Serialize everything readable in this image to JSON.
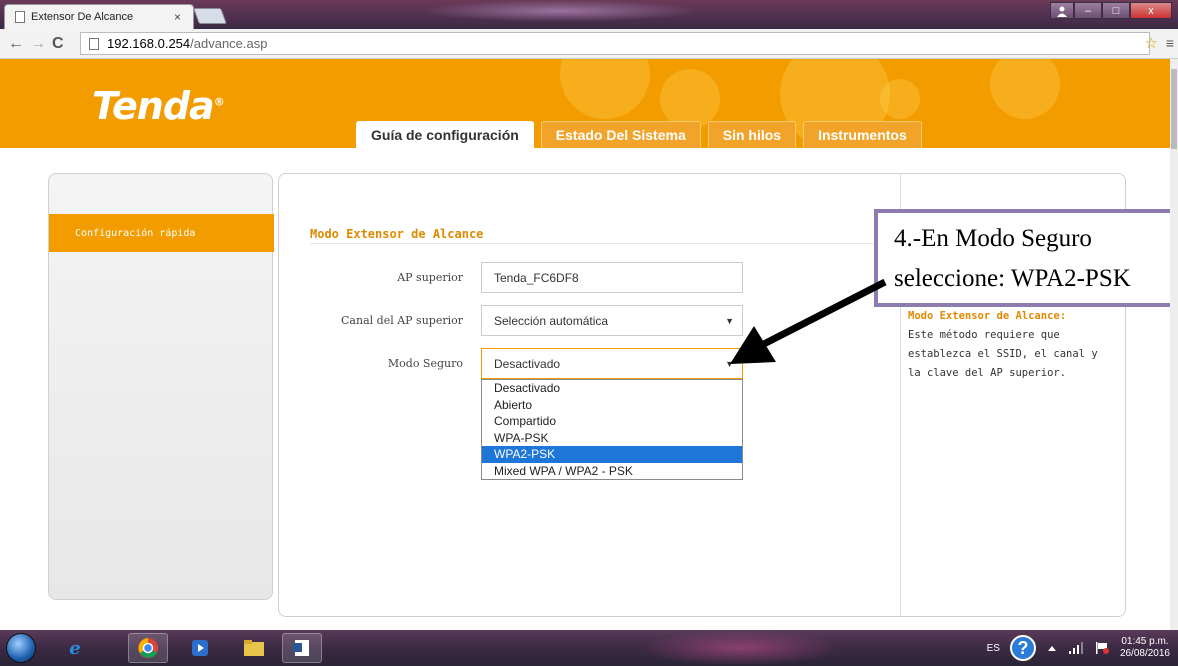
{
  "browser": {
    "tab_title": "Extensor De Alcance",
    "tab_close": "×",
    "url_host": "192.168.0.254",
    "url_path": "/advance.asp",
    "nav_back": "←",
    "nav_forward": "→",
    "nav_reload": "C",
    "star": "☆",
    "menu": "≡",
    "window_minimize": "–",
    "window_maximize": "□",
    "window_close": "x"
  },
  "header": {
    "logo": "Tenda",
    "logo_reg": "®",
    "tabs": [
      {
        "label": "Guía de configuración",
        "active": true
      },
      {
        "label": "Estado Del Sistema",
        "active": false
      },
      {
        "label": "Sin hilos",
        "active": false
      },
      {
        "label": "Instrumentos",
        "active": false
      }
    ]
  },
  "sidebar": {
    "items": [
      {
        "label": "Configuración rápida",
        "active": true
      }
    ]
  },
  "form": {
    "section_title": "Modo Extensor de Alcance",
    "ap_label": "AP superior",
    "ap_value": "Tenda_FC6DF8",
    "channel_label": "Canal del AP superior",
    "channel_value": "Selección automática",
    "security_label": "Modo Seguro",
    "security_value": "Desactivado",
    "dropdown_arrow": "▼",
    "security_options": [
      {
        "label": "Desactivado",
        "selected": false
      },
      {
        "label": "Abierto",
        "selected": false
      },
      {
        "label": "Compartido",
        "selected": false
      },
      {
        "label": "WPA-PSK",
        "selected": false
      },
      {
        "label": "WPA2-PSK",
        "selected": true
      },
      {
        "label": "Mixed WPA / WPA2 - PSK",
        "selected": false
      }
    ]
  },
  "help": {
    "title": "Modo Extensor de Alcance:",
    "body": "Este método requiere que establezca el SSID, el canal y la clave del AP superior."
  },
  "annotation": {
    "line1": "4.-En Modo Seguro",
    "line2": "seleccione: WPA2-PSK"
  },
  "taskbar": {
    "language": "ES",
    "help_glyph": "?",
    "time": "01:45 p.m.",
    "date": "26/08/2016"
  },
  "colors": {
    "brand_orange": "#f39c00",
    "selection_blue": "#1e76d9",
    "callout_border": "#8e7bb0"
  }
}
